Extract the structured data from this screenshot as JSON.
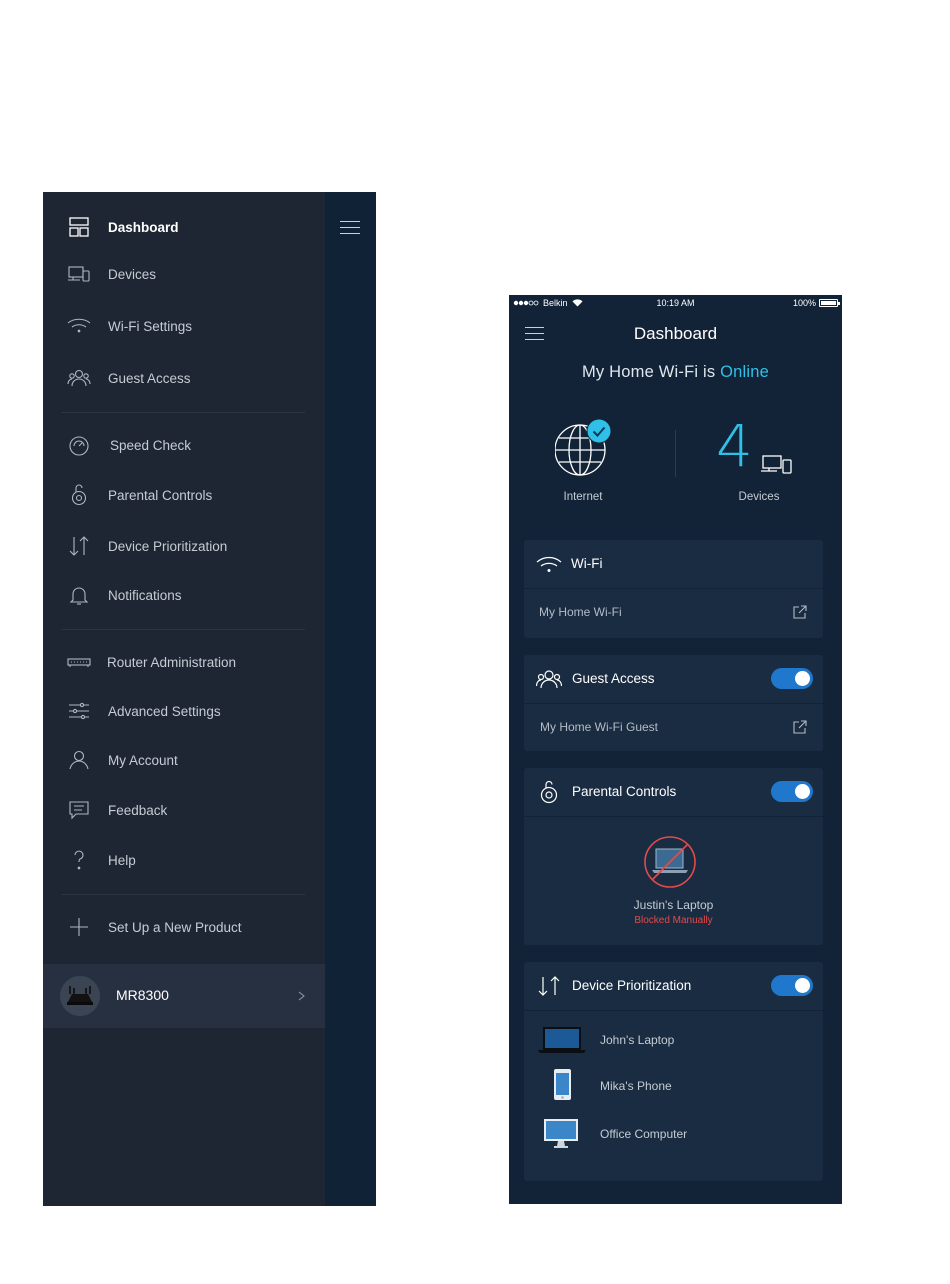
{
  "side_menu": {
    "items": [
      {
        "label": "Dashboard",
        "icon": "dashboard-icon"
      },
      {
        "label": "Devices",
        "icon": "devices-icon"
      },
      {
        "label": "Wi-Fi Settings",
        "icon": "wifi-icon"
      },
      {
        "label": "Guest Access",
        "icon": "guest-access-icon"
      },
      {
        "label": "Speed Check",
        "icon": "speedometer-icon"
      },
      {
        "label": "Parental Controls",
        "icon": "lock-icon"
      },
      {
        "label": "Device Prioritization",
        "icon": "priority-arrows-icon"
      },
      {
        "label": "Notifications",
        "icon": "bell-icon"
      },
      {
        "label": "Router Administration",
        "icon": "router-icon"
      },
      {
        "label": "Advanced Settings",
        "icon": "sliders-icon"
      },
      {
        "label": "My Account",
        "icon": "user-icon"
      },
      {
        "label": "Feedback",
        "icon": "chat-bubble-icon"
      },
      {
        "label": "Help",
        "icon": "question-icon"
      },
      {
        "label": "Set Up a New Product",
        "icon": "plus-icon"
      }
    ],
    "active_item": "Dashboard",
    "product": {
      "name": "MR8300"
    }
  },
  "dashboard": {
    "status_bar": {
      "carrier": "Belkin",
      "time": "10:19 AM",
      "battery": "100%"
    },
    "title": "Dashboard",
    "network_prefix": "My Home Wi-Fi is",
    "network_status": "Online",
    "internet_label": "Internet",
    "devices_count": "4",
    "devices_label": "Devices",
    "wifi_card": {
      "title": "Wi-Fi",
      "network_name": "My Home Wi-Fi"
    },
    "guest_card": {
      "title": "Guest Access",
      "network_name": "My Home Wi-Fi Guest",
      "enabled": true
    },
    "parental_card": {
      "title": "Parental Controls",
      "enabled": true,
      "device_name": "Justin's Laptop",
      "device_status": "Blocked Manually"
    },
    "prioritization_card": {
      "title": "Device Prioritization",
      "enabled": true,
      "devices": [
        {
          "name": "John's Laptop",
          "icon": "laptop-icon"
        },
        {
          "name": "Mika's Phone",
          "icon": "phone-icon"
        },
        {
          "name": "Office Computer",
          "icon": "desktop-icon"
        }
      ]
    },
    "colors": {
      "accent": "#2ec0e6",
      "toggle": "#1f78cc",
      "blocked": "#e24b4b",
      "background": "#132337",
      "card": "#1a2c41"
    }
  }
}
